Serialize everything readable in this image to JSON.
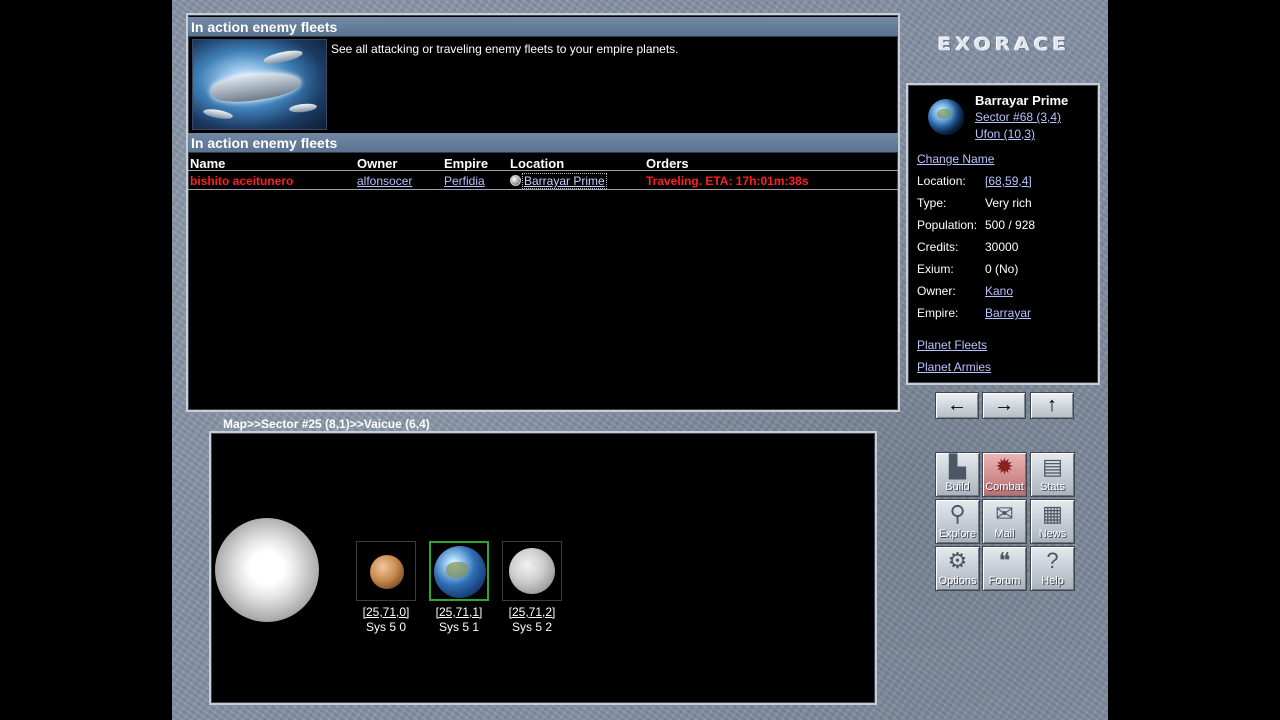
{
  "fleets_panel": {
    "header_top": "In action enemy fleets",
    "description": "See all attacking or traveling enemy fleets to your empire planets.",
    "header_table": "In action enemy fleets",
    "columns": [
      "Name",
      "Owner",
      "Empire",
      "Location",
      "Orders"
    ],
    "rows": [
      {
        "name": "bishito aceitunero",
        "owner": "alfonsocer",
        "empire": "Perfidia",
        "location": "Barrayar Prime",
        "orders": "Traveling. ETA: 17h:01m:38s"
      }
    ]
  },
  "logo": "EXORACE",
  "planet_info": {
    "name": "Barrayar Prime",
    "sector": "Sector #68 (3,4)",
    "ufon": "Ufon (10,3)",
    "change_name": "Change Name",
    "fields": [
      {
        "label": "Location:",
        "value": "[68,59,4]",
        "link": true
      },
      {
        "label": "Type:",
        "value": "Very rich",
        "link": false
      },
      {
        "label": "Population:",
        "value": "500 / 928",
        "link": false
      },
      {
        "label": "Credits:",
        "value": "30000",
        "link": false
      },
      {
        "label": "Exium:",
        "value": "0 (No)",
        "link": false
      },
      {
        "label": "Owner:",
        "value": "Kano",
        "link": true
      },
      {
        "label": "Empire:",
        "value": "Barrayar",
        "link": true
      }
    ],
    "planet_fleets": "Planet Fleets",
    "planet_armies": "Planet Armies"
  },
  "nav_arrows": [
    "←",
    "→",
    "↑"
  ],
  "map": {
    "breadcrumb": "Map>>Sector #25 (8,1)>>Vaicue (6,4)",
    "planets": [
      {
        "coord": "[25,71,0]",
        "sys": "Sys 5 0",
        "selected": false
      },
      {
        "coord": "[25,71,1]",
        "sys": "Sys 5 1",
        "selected": true
      },
      {
        "coord": "[25,71,2]",
        "sys": "Sys 5 2",
        "selected": false
      }
    ]
  },
  "menu": [
    {
      "label": "Build",
      "icon": "factory-icon",
      "glyph": "▙",
      "active": false
    },
    {
      "label": "Combat",
      "icon": "explosion-icon",
      "glyph": "✹",
      "active": true
    },
    {
      "label": "Stats",
      "icon": "chart-icon",
      "glyph": "▤",
      "active": false
    },
    {
      "label": "Explore",
      "icon": "magnifier-icon",
      "glyph": "⚲",
      "active": false
    },
    {
      "label": "Mail",
      "icon": "envelope-icon",
      "glyph": "✉",
      "active": false
    },
    {
      "label": "News",
      "icon": "newspaper-icon",
      "glyph": "▦",
      "active": false
    },
    {
      "label": "Options",
      "icon": "gears-icon",
      "glyph": "⚙",
      "active": false
    },
    {
      "label": "Forum",
      "icon": "speech-bubbles-icon",
      "glyph": "❝",
      "active": false
    },
    {
      "label": "Help",
      "icon": "question-icon",
      "glyph": "?",
      "active": false
    }
  ]
}
